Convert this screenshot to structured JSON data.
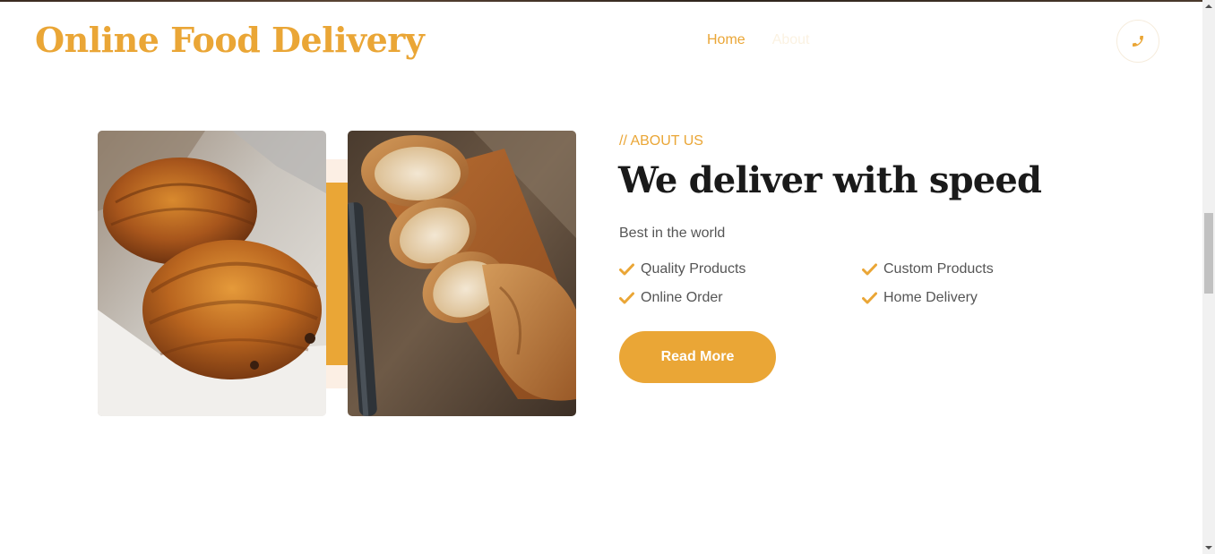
{
  "header": {
    "brand": "Online Food Delivery",
    "nav": [
      {
        "label": "Home",
        "active": true
      },
      {
        "label": "About",
        "active": false
      }
    ],
    "call_icon": "phone-icon"
  },
  "about": {
    "eyebrow": "// ABOUT US",
    "title": "We deliver with speed",
    "subtitle": "Best in the world",
    "features": [
      "Quality Products",
      "Custom Products",
      "Online Order",
      "Home Delivery"
    ],
    "feature_icon": "check-icon",
    "cta_label": "Read More",
    "images": [
      {
        "subject": "pastries on paper",
        "icon": "croissant-photo"
      },
      {
        "subject": "sliced baguette with knife",
        "icon": "bread-photo"
      }
    ]
  },
  "colors": {
    "accent": "#eaa636",
    "heading": "#1a1a1a",
    "body_text": "#555555",
    "accent_light": "#fcefe4"
  }
}
